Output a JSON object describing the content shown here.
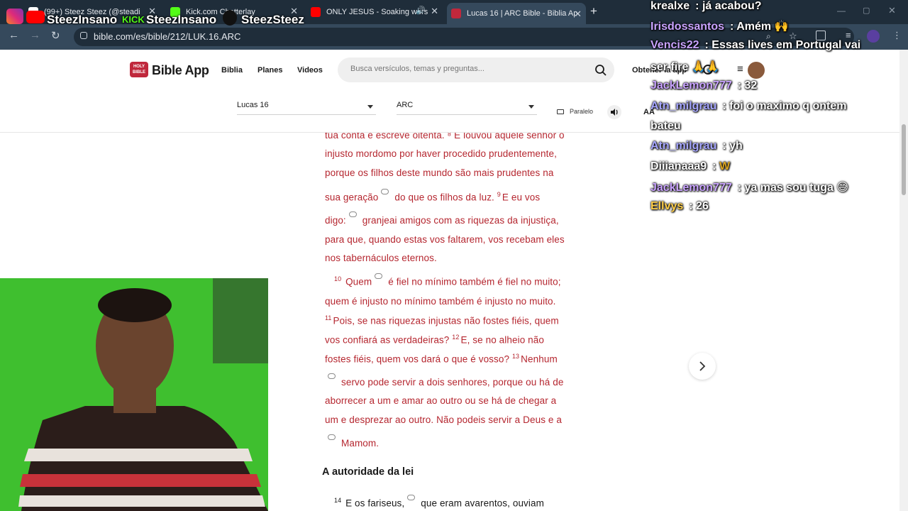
{
  "browser": {
    "tabs": [
      {
        "title": "(99+) Steez Steez (@steadi",
        "favicon_color": "#ffffff"
      },
      {
        "title": "Kick.com Chatterlay",
        "favicon_color": "#53fc18"
      },
      {
        "title": "ONLY JESUS - Soaking wors",
        "favicon_color": "#ff0000"
      },
      {
        "title": "Lucas 16 | ARC Bible - Biblia Ap",
        "favicon_color": "#c0283c"
      }
    ],
    "url": "bible.com/es/bible/212/LUK.16.ARC"
  },
  "overlay": {
    "socials": [
      {
        "name": "SteezInsano",
        "icon": "instagram-icon"
      },
      {
        "name": "SteezInsano",
        "icon": "youtube-icon"
      },
      {
        "name": "SteezSteez",
        "icon": "tiktok-icon"
      }
    ],
    "kick_label": "KICK"
  },
  "site": {
    "logo_badge": "HOLY BIBLE",
    "logo_text": "Bible App",
    "nav": [
      "Biblia",
      "Planes",
      "Videos"
    ],
    "search_placeholder": "Busca versículos, temas y preguntas...",
    "get_app": "Obtener la app",
    "book_select": "Lucas 16",
    "version_select": "ARC",
    "parallel": "Paralelo",
    "font_size_label": "AA"
  },
  "passage": {
    "lines": [
      {
        "text": "tua conta e escreve oitenta. ⁸ E louvou aquele senhor o",
        "note": false
      },
      {
        "text": "injusto mordomo por haver procedido prudentemente,",
        "note": false
      },
      {
        "text": "porque os filhos deste mundo são mais prudentes na",
        "note": false
      },
      {
        "pre": "sua geração",
        "post": "do que os filhos da luz.",
        "vnum": "9",
        "tail": "E eu vos",
        "note": true
      },
      {
        "pre": "digo:",
        "post": "granjeai amigos com as riquezas da injustiça,",
        "note": true
      },
      {
        "text": "para que, quando estas vos faltarem, vos recebam eles",
        "note": false
      },
      {
        "text": "nos tabernáculos eternos.",
        "note": false
      },
      {
        "vlead": "10",
        "pre": "Quem",
        "post": "é fiel no mínimo também é fiel no muito;",
        "note": true
      },
      {
        "text": "quem é injusto no mínimo também é injusto no muito.",
        "note": false
      },
      {
        "vlead": "11",
        "text": "Pois, se nas riquezas injustas não fostes fiéis, quem",
        "note": false
      },
      {
        "text": "vos confiará as verdadeiras?",
        "vnum": "12",
        "tail": "E, se no alheio não",
        "note": false
      },
      {
        "text": "fostes fiéis, quem vos dará o que é vosso?",
        "vnum": "13",
        "tail": "Nenhum",
        "note": false
      },
      {
        "pre": "",
        "post": "servo pode servir a dois senhores, porque ou há de",
        "note": true
      },
      {
        "text": "aborrecer a um e amar ao outro ou se há de chegar a",
        "note": false
      },
      {
        "text": "um e desprezar ao outro. Não podeis servir a Deus e a",
        "note": false
      },
      {
        "pre": "",
        "post": "Mamom.",
        "note": true
      }
    ],
    "heading": "A autoridade da lei",
    "last_line": {
      "vlead": "14",
      "pre": "E os fariseus,",
      "post": "que eram avarentos, ouviam"
    }
  },
  "chat": [
    {
      "user": "krealxe",
      "msg": "já acabou?",
      "color": "#ffffff"
    },
    {
      "user": "Irisdossantos",
      "msg": "Amém 🙌",
      "color": "#c9a3ff"
    },
    {
      "user": "Vencis22",
      "msg": "Essas lives em Portugal vai",
      "color": "#c9a3ff"
    },
    {
      "user": "",
      "msg": "ser fire 🙏🙏",
      "color": "#ffffff"
    },
    {
      "user": "JackLemon777",
      "msg": "32",
      "color": "#c9a3ff"
    },
    {
      "user": "Atn_milgrau",
      "msg": "foi o maximo q ontem",
      "color": "#a6a6ff"
    },
    {
      "user": "",
      "msg": "bateu",
      "color": "#ffffff"
    },
    {
      "user": "Atn_milgrau",
      "msg": "yh",
      "color": "#a6a6ff"
    },
    {
      "user": "Diiianaaa9",
      "msg": "W",
      "color": "#ffffff"
    },
    {
      "user": "JackLemon777",
      "msg": "ya mas sou tuga 😅",
      "color": "#c9a3ff"
    },
    {
      "user": "Ellvys",
      "msg": "26",
      "color": "#ffcf4a"
    }
  ]
}
